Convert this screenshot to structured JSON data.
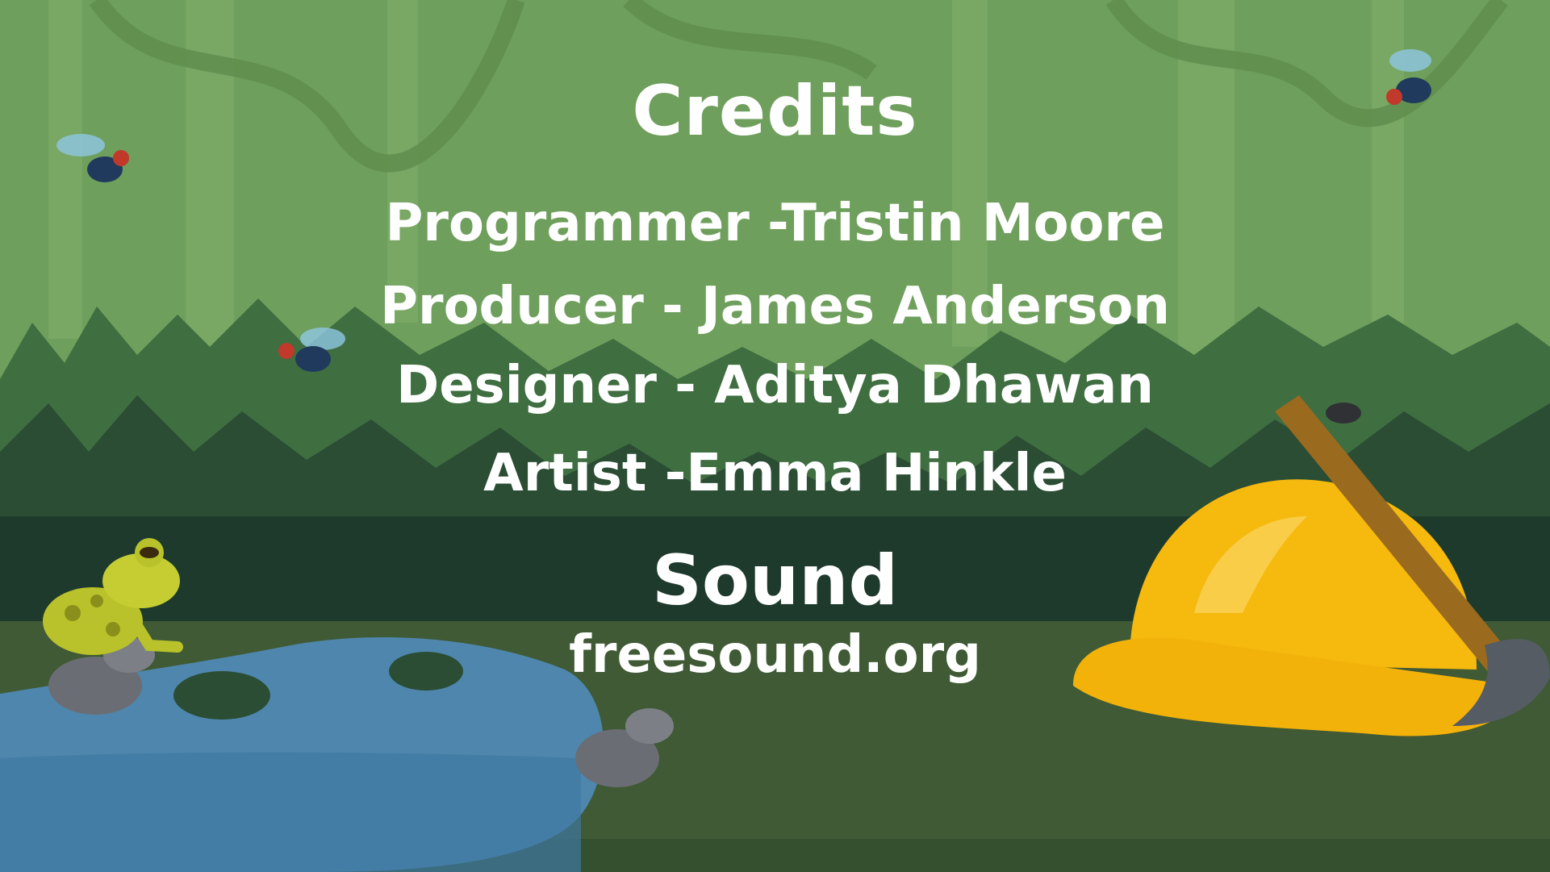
{
  "screen": "credits",
  "title": "Credits",
  "credits": [
    {
      "text": "Programmer -Tristin Moore"
    },
    {
      "text": "Producer - James Anderson"
    },
    {
      "text": "Designer - Aditya Dhawan"
    },
    {
      "text": "Artist -Emma Hinkle"
    }
  ],
  "sound": {
    "title": "Sound",
    "source": "freesound.org"
  },
  "colors": {
    "sky": "#6f9f5c",
    "jungle_dark": "#1e3a2c",
    "ground": "#3f5a35",
    "water": "#4f86ad",
    "helmet": "#f6b90e",
    "text": "#ffffff"
  },
  "decorations": [
    "fly-icon",
    "fly-icon",
    "fly-icon",
    "frog-icon",
    "pond",
    "lily-pad-icon",
    "rock-icon",
    "hard-hat-icon",
    "pickaxe-icon",
    "beetle-icon"
  ]
}
